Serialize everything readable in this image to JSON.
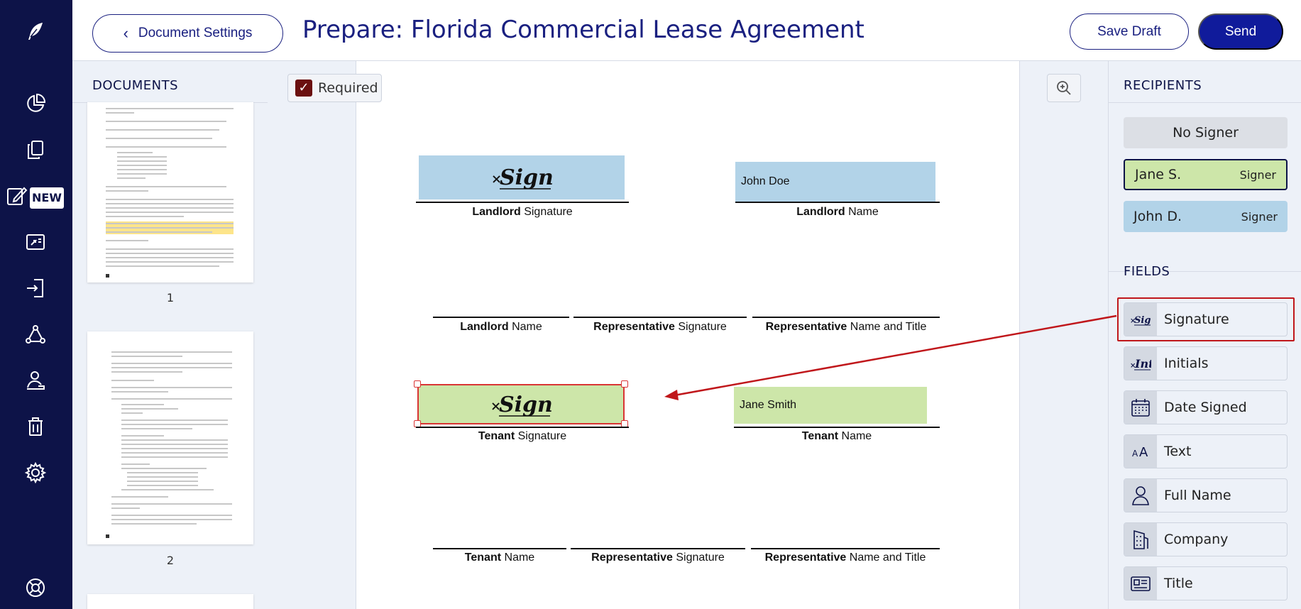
{
  "header": {
    "settings_label": "Document Settings",
    "title": "Prepare: Florida Commercial Lease Agreement",
    "save_draft_label": "Save Draft",
    "send_label": "Send"
  },
  "nav": {
    "new_badge": "NEW"
  },
  "documents": {
    "heading": "DOCUMENTS",
    "pages": [
      "1",
      "2"
    ]
  },
  "canvas": {
    "required_label": "Required",
    "fields": {
      "landlord_name_value": "John Doe",
      "tenant_name_value": "Jane Smith"
    },
    "labels": {
      "landlord_signature": {
        "bold": "Landlord",
        "rest": " Signature"
      },
      "landlord_name_top": {
        "bold": "Landlord",
        "rest": " Name"
      },
      "landlord_name": {
        "bold": "Landlord",
        "rest": " Name"
      },
      "rep_signature_1": {
        "bold": "Representative",
        "rest": " Signature"
      },
      "rep_name_title_1": {
        "bold": "Representative",
        "rest": " Name and Title"
      },
      "tenant_signature": {
        "bold": "Tenant",
        "rest": " Signature"
      },
      "tenant_name_top": {
        "bold": "Tenant",
        "rest": " Name"
      },
      "tenant_name": {
        "bold": "Tenant",
        "rest": " Name"
      },
      "rep_signature_2": {
        "bold": "Representative",
        "rest": " Signature"
      },
      "rep_name_title_2": {
        "bold": "Representative",
        "rest": " Name and Title"
      }
    }
  },
  "recipients": {
    "heading": "RECIPIENTS",
    "no_signer": "No Signer",
    "list": [
      {
        "name": "Jane S.",
        "role": "Signer",
        "color": "#cde6a9"
      },
      {
        "name": "John D.",
        "role": "Signer",
        "color": "#b2d3e8"
      }
    ]
  },
  "fields": {
    "heading": "FIELDS",
    "items": [
      {
        "label": "Signature",
        "icon": "xsign-icon"
      },
      {
        "label": "Initials",
        "icon": "initials-icon"
      },
      {
        "label": "Date Signed",
        "icon": "calendar-icon"
      },
      {
        "label": "Text",
        "icon": "text-icon"
      },
      {
        "label": "Full Name",
        "icon": "person-icon"
      },
      {
        "label": "Company",
        "icon": "building-icon"
      },
      {
        "label": "Title",
        "icon": "id-card-icon"
      }
    ]
  },
  "colors": {
    "nav": "#0d1348",
    "accent": "#101b9b",
    "landlord_field": "#b2d3e8",
    "tenant_field": "#cde6a9",
    "highlight": "#c0171b"
  }
}
